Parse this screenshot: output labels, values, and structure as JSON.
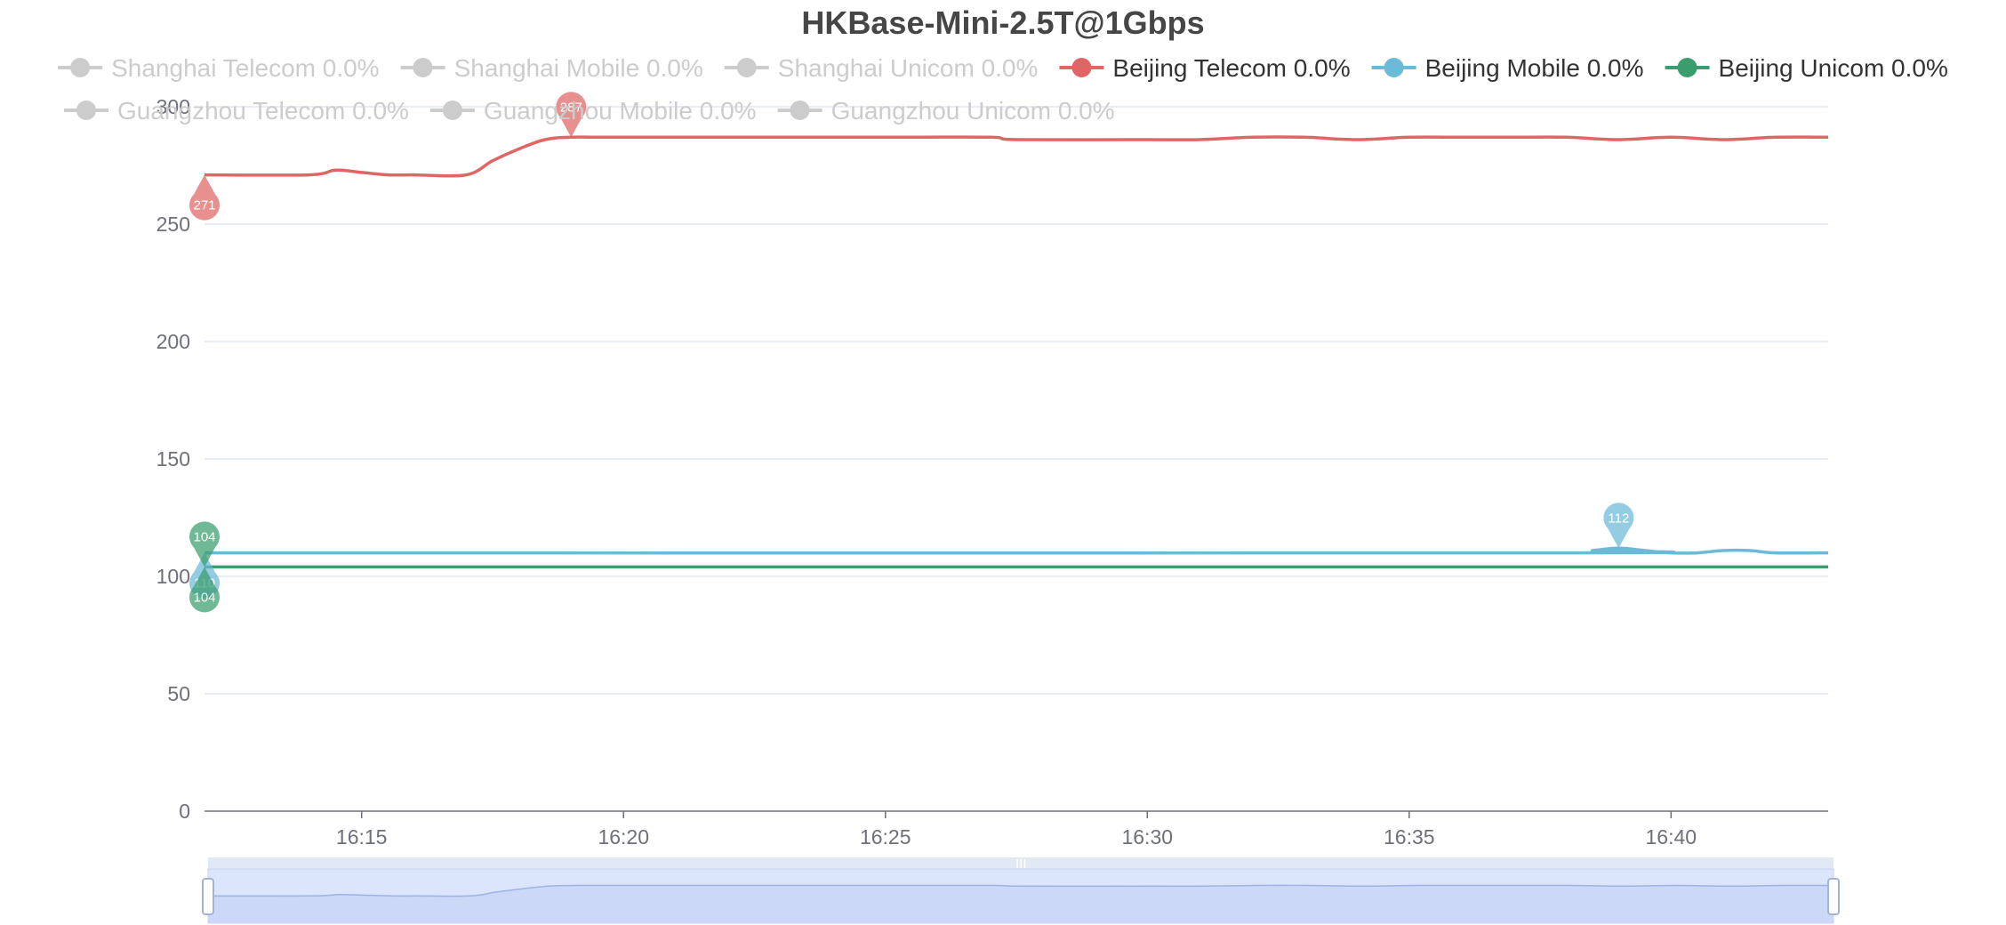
{
  "chart_data": {
    "type": "line",
    "title": "HKBase-Mini-2.5T@1Gbps",
    "xlabel": "",
    "ylabel": "",
    "x_ticks": [
      "16:15",
      "16:20",
      "16:25",
      "16:30",
      "16:35",
      "16:40"
    ],
    "y_ticks": [
      0,
      50,
      100,
      150,
      200,
      250,
      300
    ],
    "xlim": [
      "16:12",
      "16:43"
    ],
    "ylim": [
      0,
      300
    ],
    "grid": "horizontal",
    "legend_position": "top",
    "series": [
      {
        "name": "Shanghai Telecom 0.0%",
        "color": "#cccccc",
        "active": false,
        "values": []
      },
      {
        "name": "Shanghai Mobile 0.0%",
        "color": "#cccccc",
        "active": false,
        "values": []
      },
      {
        "name": "Shanghai Unicom 0.0%",
        "color": "#cccccc",
        "active": false,
        "values": []
      },
      {
        "name": "Beijing Telecom 0.0%",
        "color": "#e06666",
        "active": true,
        "points": [
          [
            "16:12",
            271
          ],
          [
            "16:14",
            271
          ],
          [
            "16:14:30",
            273
          ],
          [
            "16:15",
            272
          ],
          [
            "16:15:30",
            271
          ],
          [
            "16:16",
            271
          ],
          [
            "16:17",
            271
          ],
          [
            "16:17:30",
            277
          ],
          [
            "16:18",
            282
          ],
          [
            "16:18:30",
            286
          ],
          [
            "16:19",
            287
          ],
          [
            "16:20",
            287
          ],
          [
            "16:25",
            287
          ],
          [
            "16:27",
            287
          ],
          [
            "16:27:30",
            286
          ],
          [
            "16:30",
            286
          ],
          [
            "16:31",
            286
          ],
          [
            "16:32",
            287
          ],
          [
            "16:33",
            287
          ],
          [
            "16:34",
            286
          ],
          [
            "16:35",
            287
          ],
          [
            "16:36",
            287
          ],
          [
            "16:37",
            287
          ],
          [
            "16:38",
            287
          ],
          [
            "16:39",
            286
          ],
          [
            "16:40",
            287
          ],
          [
            "16:41",
            286
          ],
          [
            "16:42",
            287
          ],
          [
            "16:43",
            287
          ]
        ],
        "markers": [
          {
            "label": "271",
            "x": "16:12",
            "y": 271,
            "kind": "min"
          },
          {
            "label": "287",
            "x": "16:19",
            "y": 287,
            "kind": "max"
          }
        ]
      },
      {
        "name": "Beijing Mobile 0.0%",
        "color": "#6bbad8",
        "active": true,
        "points": [
          [
            "16:12",
            110
          ],
          [
            "16:38",
            110
          ],
          [
            "16:38:30",
            111
          ],
          [
            "16:39",
            112
          ],
          [
            "16:39:30",
            111
          ],
          [
            "16:40",
            110
          ],
          [
            "16:40:30",
            110
          ],
          [
            "16:41",
            111
          ],
          [
            "16:41:30",
            111
          ],
          [
            "16:42",
            110
          ],
          [
            "16:43",
            110
          ]
        ],
        "markers": [
          {
            "label": "110",
            "x": "16:12",
            "y": 110,
            "kind": "min"
          },
          {
            "label": "112",
            "x": "16:39",
            "y": 112,
            "kind": "max"
          }
        ]
      },
      {
        "name": "Beijing Unicom 0.0%",
        "color": "#3a9d6e",
        "active": true,
        "points": [
          [
            "16:12",
            104
          ],
          [
            "16:43",
            104
          ]
        ],
        "markers": [
          {
            "label": "104",
            "x": "16:12",
            "y": 104,
            "kind": "max"
          },
          {
            "label": "104",
            "x": "16:12",
            "y": 104,
            "kind": "min"
          }
        ]
      },
      {
        "name": "Guangzhou Telecom 0.0%",
        "color": "#cccccc",
        "active": false,
        "values": []
      },
      {
        "name": "Guangzhou Mobile 0.0%",
        "color": "#cccccc",
        "active": false,
        "values": []
      },
      {
        "name": "Guangzhou Unicom 0.0%",
        "color": "#cccccc",
        "active": false,
        "values": []
      }
    ],
    "data_zoom": {
      "start": "16:12",
      "end": "16:43",
      "handle_label": "III"
    }
  }
}
